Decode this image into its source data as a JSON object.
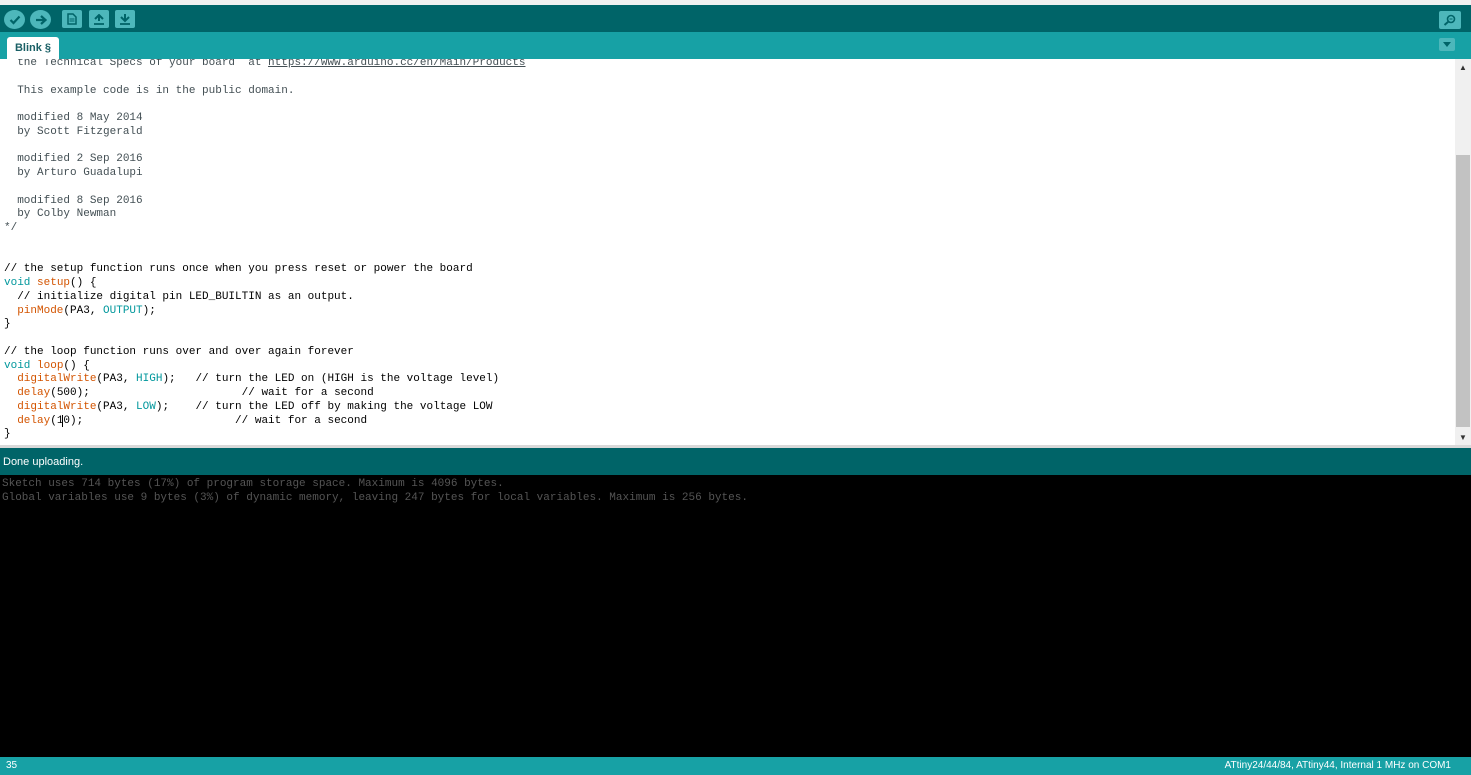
{
  "sketch": {
    "tab_label": "Blink §"
  },
  "editor": {
    "lines": [
      [
        {
          "t": "c",
          "v": "  the Technical Specs of your board  at "
        },
        {
          "t": "cu",
          "v": "https://www.arduino.cc/en/Main/Products"
        }
      ],
      [
        {
          "t": "c",
          "v": ""
        }
      ],
      [
        {
          "t": "c",
          "v": "  This example code is in the public domain."
        }
      ],
      [
        {
          "t": "c",
          "v": ""
        }
      ],
      [
        {
          "t": "c",
          "v": "  modified 8 May 2014"
        }
      ],
      [
        {
          "t": "c",
          "v": "  by Scott Fitzgerald"
        }
      ],
      [
        {
          "t": "c",
          "v": ""
        }
      ],
      [
        {
          "t": "c",
          "v": "  modified 2 Sep 2016"
        }
      ],
      [
        {
          "t": "c",
          "v": "  by Arturo Guadalupi"
        }
      ],
      [
        {
          "t": "c",
          "v": ""
        }
      ],
      [
        {
          "t": "c",
          "v": "  modified 8 Sep 2016"
        }
      ],
      [
        {
          "t": "c",
          "v": "  by Colby Newman"
        }
      ],
      [
        {
          "t": "c",
          "v": "*/"
        }
      ],
      [
        {
          "t": "n",
          "v": ""
        }
      ],
      [
        {
          "t": "n",
          "v": ""
        }
      ],
      [
        {
          "t": "n",
          "v": "// the setup function runs once when you press reset or power the board"
        }
      ],
      [
        {
          "t": "k",
          "v": "void"
        },
        {
          "t": "n",
          "v": " "
        },
        {
          "t": "f",
          "v": "setup"
        },
        {
          "t": "n",
          "v": "() {"
        }
      ],
      [
        {
          "t": "n",
          "v": "  // initialize digital pin LED_BUILTIN as an output."
        }
      ],
      [
        {
          "t": "n",
          "v": "  "
        },
        {
          "t": "f",
          "v": "pinMode"
        },
        {
          "t": "n",
          "v": "(PA3, "
        },
        {
          "t": "k",
          "v": "OUTPUT"
        },
        {
          "t": "n",
          "v": ");"
        }
      ],
      [
        {
          "t": "n",
          "v": "}"
        }
      ],
      [
        {
          "t": "n",
          "v": ""
        }
      ],
      [
        {
          "t": "n",
          "v": "// the loop function runs over and over again forever"
        }
      ],
      [
        {
          "t": "k",
          "v": "void"
        },
        {
          "t": "n",
          "v": " "
        },
        {
          "t": "f",
          "v": "loop"
        },
        {
          "t": "n",
          "v": "() {"
        }
      ],
      [
        {
          "t": "n",
          "v": "  "
        },
        {
          "t": "f",
          "v": "digitalWrite"
        },
        {
          "t": "n",
          "v": "(PA3, "
        },
        {
          "t": "k",
          "v": "HIGH"
        },
        {
          "t": "n",
          "v": ");   // turn the LED on (HIGH is the voltage level)"
        }
      ],
      [
        {
          "t": "n",
          "v": "  "
        },
        {
          "t": "f",
          "v": "delay"
        },
        {
          "t": "n",
          "v": "(500);                       // wait for a second"
        }
      ],
      [
        {
          "t": "n",
          "v": "  "
        },
        {
          "t": "f",
          "v": "digitalWrite"
        },
        {
          "t": "n",
          "v": "(PA3, "
        },
        {
          "t": "k",
          "v": "LOW"
        },
        {
          "t": "n",
          "v": ");    // turn the LED off by making the voltage LOW"
        }
      ],
      [
        {
          "t": "n",
          "v": "  "
        },
        {
          "t": "f",
          "v": "delay"
        },
        {
          "t": "n",
          "v": "(1"
        },
        {
          "t": "caret",
          "v": ""
        },
        {
          "t": "n",
          "v": "0);                       // wait for a second"
        }
      ],
      [
        {
          "t": "n",
          "v": "}"
        }
      ]
    ]
  },
  "status": {
    "message": "Done uploading."
  },
  "console": {
    "lines": [
      "Sketch uses 714 bytes (17%) of program storage space. Maximum is 4096 bytes.",
      "Global variables use 9 bytes (3%) of dynamic memory, leaving 247 bytes for local variables. Maximum is 256 bytes."
    ]
  },
  "footer": {
    "line_number": "35",
    "board_info": "ATtiny24/44/84, ATtiny44, Internal 1 MHz on COM1"
  },
  "toolbar": {
    "icons": [
      "verify-icon",
      "upload-icon",
      "new-icon",
      "open-icon",
      "save-icon",
      "serial-monitor-icon"
    ]
  },
  "colors": {
    "toolbar": "#006468",
    "tabbar": "#17a1a5",
    "button": "#4db7bb",
    "keyword": "#00979c",
    "function": "#d35400",
    "comment": "#434f54"
  }
}
